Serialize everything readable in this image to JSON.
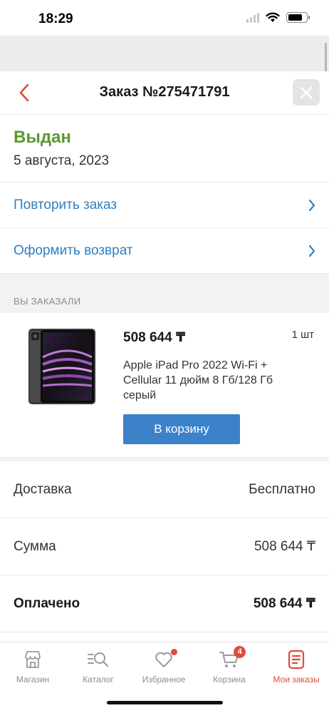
{
  "status_bar": {
    "time": "18:29",
    "icons": [
      "signal-icon",
      "wifi-icon",
      "battery-icon"
    ]
  },
  "header": {
    "title": "Заказ №275471791",
    "back_icon": "chevron-left-icon",
    "close_icon": "close-icon"
  },
  "order": {
    "status": "Выдан",
    "date": "5 августа, 2023",
    "status_color": "#5b9a2f"
  },
  "actions": [
    {
      "label": "Повторить заказ"
    },
    {
      "label": "Оформить возврат"
    }
  ],
  "ordered_section": {
    "title": "ВЫ ЗАКАЗАЛИ"
  },
  "product": {
    "price": "508 644 ₸",
    "quantity": "1 шт",
    "name": "Apple iPad Pro 2022 Wi-Fi + Cellular 11 дюйм 8 Гб/128 Гб серый",
    "button_label": "В корзину"
  },
  "summary": [
    {
      "label": "Доставка",
      "value": "Бесплатно"
    },
    {
      "label": "Сумма",
      "value": "508 644 ₸"
    },
    {
      "label": "Оплачено",
      "value": "508 644 ₸"
    }
  ],
  "tabbar": {
    "items": [
      {
        "label": "Магазин",
        "icon": "store-icon"
      },
      {
        "label": "Каталог",
        "icon": "catalog-search-icon"
      },
      {
        "label": "Избранное",
        "icon": "heart-icon",
        "badge_dot": true
      },
      {
        "label": "Корзина",
        "icon": "cart-icon",
        "badge": "4"
      },
      {
        "label": "Мои заказы",
        "icon": "orders-icon",
        "active": true
      }
    ]
  },
  "colors": {
    "accent_blue": "#2f7fc1",
    "button_blue": "#3b82c9",
    "brand_red": "#e04b3b"
  }
}
